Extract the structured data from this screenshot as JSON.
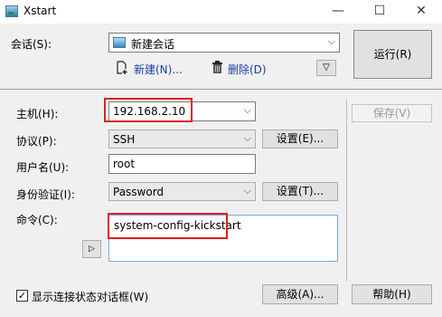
{
  "window": {
    "title": "Xstart",
    "minimize": "—",
    "maximize": "☐",
    "close": "✕"
  },
  "session": {
    "label": "会话(S):",
    "value": "新建会话",
    "new_label": "新建(N)...",
    "delete_label": "删除(D)",
    "more": "▽"
  },
  "buttons": {
    "run": "运行(R)",
    "save": "保存(V)",
    "help": "帮助(H)",
    "advanced": "高级(A)..."
  },
  "form": {
    "host_label": "主机(H):",
    "host_value": "192.168.2.10",
    "protocol_label": "协议(P):",
    "protocol_value": "SSH",
    "protocol_settings": "设置(E)...",
    "user_label": "用户名(U):",
    "user_value": "root",
    "auth_label": "身份验证(I):",
    "auth_value": "Password",
    "auth_settings": "设置(T)...",
    "command_label": "命令(C):",
    "command_value": "system-config-kickstart",
    "expand_arrow": "▷"
  },
  "footer": {
    "show_status_label": "显示连接状态对话框(W)",
    "show_status_checked": "✓"
  }
}
